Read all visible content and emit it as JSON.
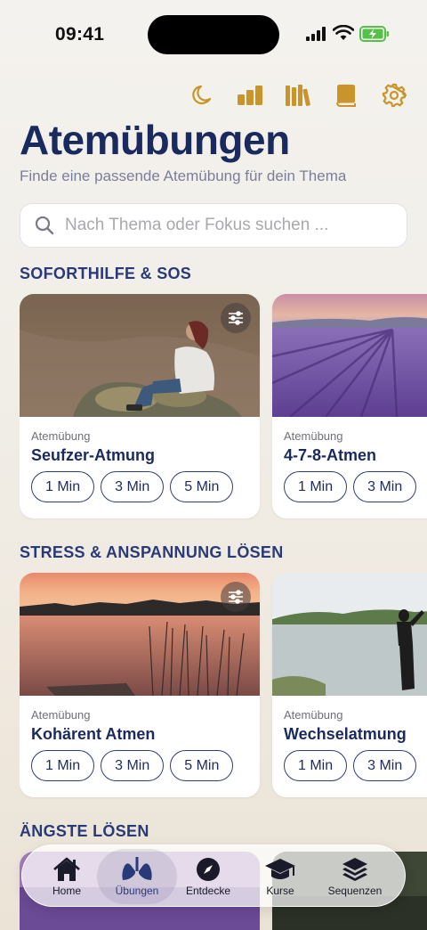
{
  "status_bar": {
    "time": "09:41"
  },
  "toolbar": {
    "icons": [
      "moon-icon",
      "stats-bars-icon",
      "library-books-icon",
      "book-icon",
      "gear-icon"
    ]
  },
  "header": {
    "title": "Atemübungen",
    "subtitle": "Finde eine passende Atemübung für dein Thema"
  },
  "search": {
    "placeholder": "Nach Thema oder Fokus suchen ...",
    "value": ""
  },
  "sections": [
    {
      "title": "SOFORTHILFE & SOS",
      "cards": [
        {
          "type": "Atemübung",
          "title": "Seufzer-Atmung",
          "durations": [
            "1 Min",
            "3 Min",
            "5 Min"
          ]
        },
        {
          "type": "Atemübung",
          "title": "4-7-8-Atmen",
          "durations": [
            "1 Min",
            "3 Min"
          ]
        }
      ]
    },
    {
      "title": "STRESS & ANSPANNUNG LÖSEN",
      "cards": [
        {
          "type": "Atemübung",
          "title": "Kohärent Atmen",
          "durations": [
            "1 Min",
            "3 Min",
            "5 Min"
          ]
        },
        {
          "type": "Atemübung",
          "title": "Wechselatmung",
          "durations": [
            "1 Min",
            "3 Min"
          ]
        }
      ]
    },
    {
      "title": "ÄNGSTE LÖSEN"
    }
  ],
  "tab_bar": {
    "active": "Übungen",
    "tabs": [
      {
        "label": "Home",
        "icon": "home-icon"
      },
      {
        "label": "Übungen",
        "icon": "lungs-icon"
      },
      {
        "label": "Entdecke",
        "icon": "compass-icon"
      },
      {
        "label": "Kurse",
        "icon": "graduation-cap-icon"
      },
      {
        "label": "Sequenzen",
        "icon": "layers-icon"
      }
    ]
  },
  "colors": {
    "accent_gold": "#c9952b",
    "navy": "#1b2a5e",
    "subtitle": "#7b7d9c"
  }
}
